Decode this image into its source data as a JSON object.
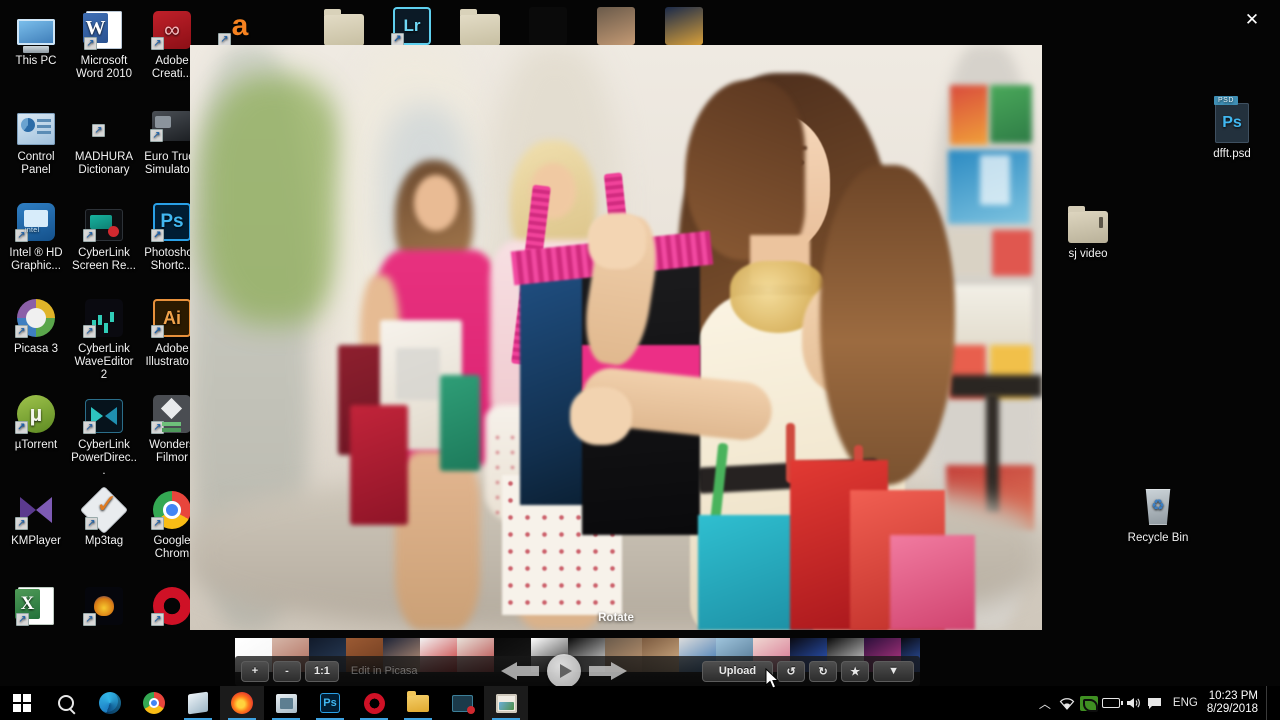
{
  "desktop": {
    "icons_left": [
      {
        "label": "This PC",
        "icon": "computer-icon",
        "shortcut": false
      },
      {
        "label": "Microsoft Word 2010",
        "icon": "word-icon",
        "shortcut": true
      },
      {
        "label": "Adobe Creati...",
        "icon": "adobe-creative-cloud-icon",
        "shortcut": true
      },
      {
        "label": "Control Panel",
        "icon": "control-panel-icon",
        "shortcut": false
      },
      {
        "label": "MADHURA Dictionary",
        "icon": "dictionary-icon",
        "shortcut": true
      },
      {
        "label": "Euro Truck Simulato...",
        "icon": "euro-truck-simulator-icon",
        "shortcut": true
      },
      {
        "label": "Intel ® HD Graphic...",
        "icon": "intel-hd-graphics-icon",
        "shortcut": true
      },
      {
        "label": "CyberLink Screen Re...",
        "icon": "cyberlink-screen-recorder-icon",
        "shortcut": true
      },
      {
        "label": "Photosho - Shortc...",
        "icon": "photoshop-icon",
        "shortcut": true
      },
      {
        "label": "Picasa 3",
        "icon": "picasa-icon",
        "shortcut": true
      },
      {
        "label": "CyberLink WaveEditor 2",
        "icon": "cyberlink-waveeditor-icon",
        "shortcut": true
      },
      {
        "label": "Adobe Illustrato...",
        "icon": "adobe-illustrator-icon",
        "shortcut": true
      },
      {
        "label": "µTorrent",
        "icon": "utorrent-icon",
        "shortcut": true
      },
      {
        "label": "CyberLink PowerDirec...",
        "icon": "cyberlink-powerdirector-icon",
        "shortcut": true
      },
      {
        "label": "Wonders Filmor",
        "icon": "wondershare-filmora-icon",
        "shortcut": true
      },
      {
        "label": "KMPlayer",
        "icon": "kmplayer-icon",
        "shortcut": true
      },
      {
        "label": "Mp3tag",
        "icon": "mp3tag-icon",
        "shortcut": true
      },
      {
        "label": "Google Chrom",
        "icon": "google-chrome-icon",
        "shortcut": true
      },
      {
        "label": "",
        "icon": "excel-icon",
        "shortcut": true
      },
      {
        "label": "",
        "icon": "media-player-icon",
        "shortcut": true
      },
      {
        "label": "",
        "icon": "opera-icon",
        "shortcut": true
      }
    ],
    "icons_top": [
      {
        "label": "",
        "icon": "avast-icon",
        "shortcut": true
      },
      {
        "label": "",
        "icon": "folder-icon",
        "shortcut": false
      },
      {
        "label": "",
        "icon": "adobe-lightroom-icon",
        "shortcut": true
      },
      {
        "label": "",
        "icon": "folder-icon",
        "shortcut": false
      },
      {
        "label": "",
        "icon": "necklace-thumb-icon",
        "shortcut": false
      },
      {
        "label": "",
        "icon": "photo-thumb-icon",
        "shortcut": false
      },
      {
        "label": "",
        "icon": "photo-thumb-icon",
        "shortcut": false
      }
    ],
    "icons_right": [
      {
        "label": "dfft.psd",
        "icon": "psd-file-icon",
        "shortcut": false
      },
      {
        "label": "sj video",
        "icon": "folder-icon",
        "shortcut": false
      },
      {
        "label": "Recycle Bin",
        "icon": "recycle-bin-icon",
        "shortcut": false
      }
    ]
  },
  "viewer": {
    "close_label": "✕",
    "tooltip": "Rotate",
    "toolbar": {
      "zoom_in_label": "+",
      "zoom_out_label": "-",
      "actual_size_label": "1:1",
      "edit_label": "Edit in Picasa",
      "upload_label": "Upload",
      "rotate_left_label": "↺",
      "rotate_right_label": "↻",
      "star_label": "★",
      "more_label": "▼",
      "prev_label": "previous-image",
      "next_label": "next-image",
      "play_label": "slideshow-play"
    },
    "filmstrip": [
      {
        "name": "thumb-blank-1",
        "color1": "#ffffff",
        "color2": "#f4f4f4"
      },
      {
        "name": "thumb-collage",
        "color1": "#d5b6a8",
        "color2": "#b06a5a"
      },
      {
        "name": "thumb-dark-blue",
        "color1": "#111a2a",
        "color2": "#2a3f5c"
      },
      {
        "name": "thumb-brick",
        "color1": "#9b5a33",
        "color2": "#6e3b1f"
      },
      {
        "name": "thumb-portrait-man",
        "color1": "#1c2336",
        "color2": "#c89c7e"
      },
      {
        "name": "thumb-stamp-red",
        "color1": "#f2f2f2",
        "color2": "#c62b2b"
      },
      {
        "name": "thumb-woman-red",
        "color1": "#e8e2da",
        "color2": "#b33a3a"
      },
      {
        "name": "thumb-dark-1",
        "color1": "#0a0a0a",
        "color2": "#1a1a1a"
      },
      {
        "name": "thumb-compass-logo",
        "color1": "#ffffff",
        "color2": "#2b2b2b"
      },
      {
        "name": "thumb-arabic-text",
        "color1": "#0b0b0b",
        "color2": "#e8e8e8"
      },
      {
        "name": "thumb-two-people",
        "color1": "#6a5a4a",
        "color2": "#c49a74"
      },
      {
        "name": "thumb-shop-interior",
        "color1": "#7b5a3f",
        "color2": "#d8b48a"
      },
      {
        "name": "thumb-checkerboard",
        "color1": "#dcdcdc",
        "color2": "#2f6fb0"
      },
      {
        "name": "thumb-city-sky",
        "color1": "#9fc4dc",
        "color2": "#4a6f8c"
      },
      {
        "name": "thumb-woman-pink",
        "color1": "#f0d8d2",
        "color2": "#d46a8a"
      },
      {
        "name": "thumb-blue-swirl",
        "color1": "#0a0a12",
        "color2": "#2f5fd0"
      },
      {
        "name": "thumb-black-logo",
        "color1": "#0a0a0a",
        "color2": "#e8e8e8"
      },
      {
        "name": "thumb-purple-banner",
        "color1": "#2a0f3a",
        "color2": "#c23a8a"
      },
      {
        "name": "thumb-blue-swirl-2",
        "color1": "#0a0a12",
        "color2": "#3a6fe0"
      },
      {
        "name": "thumb-white-logo",
        "color1": "#ffffff",
        "color2": "#1f7fc4"
      },
      {
        "name": "thumb-night-city",
        "color1": "#1a1a2e",
        "color2": "#d8a03a"
      },
      {
        "name": "thumb-necklace",
        "color1": "#0a0a0a",
        "color2": "#e0e0e0"
      },
      {
        "name": "thumb-blue-object",
        "color1": "#f4f4f4",
        "color2": "#2f6fb0"
      },
      {
        "name": "thumb-blank-2",
        "color1": "#ffffff",
        "color2": "#fafafa"
      }
    ]
  },
  "taskbar": {
    "items": [
      {
        "name": "start-button",
        "icon": "windows-logo-icon",
        "running": false,
        "active": false
      },
      {
        "name": "search-button",
        "icon": "search-icon",
        "running": false,
        "active": false
      },
      {
        "name": "taskbar-edge",
        "icon": "microsoft-edge-icon",
        "running": false,
        "active": false
      },
      {
        "name": "taskbar-chrome",
        "icon": "google-chrome-icon",
        "running": false,
        "active": false
      },
      {
        "name": "taskbar-store",
        "icon": "microsoft-store-icon",
        "running": true,
        "active": false
      },
      {
        "name": "taskbar-firefox",
        "icon": "firefox-icon",
        "running": true,
        "active": true
      },
      {
        "name": "taskbar-picasa",
        "icon": "picasa-icon",
        "running": true,
        "active": false
      },
      {
        "name": "taskbar-photoshop",
        "icon": "photoshop-icon",
        "running": true,
        "active": false
      },
      {
        "name": "taskbar-opera",
        "icon": "opera-icon",
        "running": true,
        "active": false
      },
      {
        "name": "taskbar-file-explorer",
        "icon": "folder-icon",
        "running": true,
        "active": false
      },
      {
        "name": "taskbar-screen-recorder",
        "icon": "screen-recorder-icon",
        "running": false,
        "active": false
      },
      {
        "name": "taskbar-photo-viewer",
        "icon": "photo-viewer-icon",
        "running": true,
        "active": true
      }
    ],
    "tray": {
      "chevron": "︿",
      "wifi": "📶",
      "nvidia": "nvidia-icon",
      "battery": "battery-icon",
      "volume": "🔊",
      "notifications": "🗨",
      "language": "ENG",
      "time": "10:23 PM",
      "date": "8/29/2018"
    }
  },
  "colors": {
    "accent": "#3ea2e0",
    "taskbar_bg": "#000000",
    "desktop_bg": "#050505",
    "toolbar_bg": "#1a1a1a"
  }
}
